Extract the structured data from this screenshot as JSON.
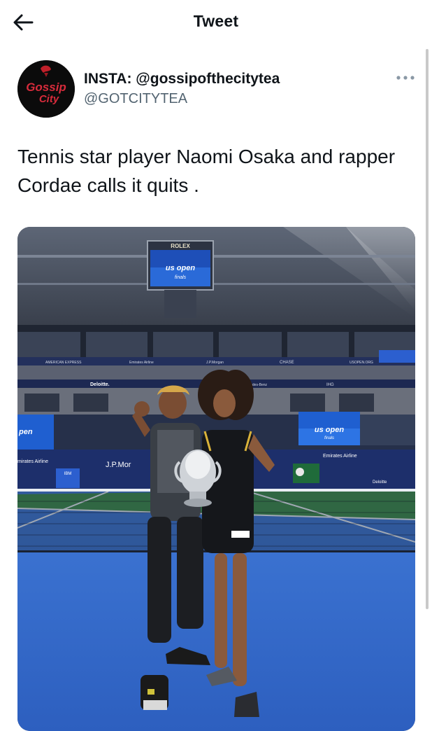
{
  "header": {
    "title": "Tweet",
    "back_icon": "arrow-left-icon"
  },
  "tweet": {
    "avatar": {
      "line1": "Gossip",
      "line2": "City"
    },
    "display_name": "INSTA: @gossipofthecitytea",
    "handle": "@GOTCITYTEA",
    "more_icon": "more-horizontal-icon",
    "text": "Tennis star player Naomi Osaka and rapper Cordae calls it quits ."
  },
  "photo": {
    "scoreboard_brand": "ROLEX",
    "banners": {
      "american_express": "AMERICAN EXPRESS",
      "emirates_small": "Emirates Airline",
      "jpmorgan_small": "J.P.Morgan",
      "chase": "CHASE",
      "usopen_org": "USOPEN.ORG",
      "deloitte": "Deloitte.",
      "mercedes": "Mercedes-Benz",
      "ihg": "IHG",
      "emirates_large": "Emirates Airline",
      "emirates_left": "mirates Airline",
      "jpmorgan_large": "J.P.Mor",
      "ibm": "IBM",
      "deloitte_small": "Deloitte"
    },
    "screens": {
      "usopen": "us open",
      "finals": "finals",
      "left_screen": "pen"
    }
  },
  "colors": {
    "accent": "#1d9bf0",
    "court_blue": "#3b6fd1",
    "court_green": "#3d8a4c"
  }
}
